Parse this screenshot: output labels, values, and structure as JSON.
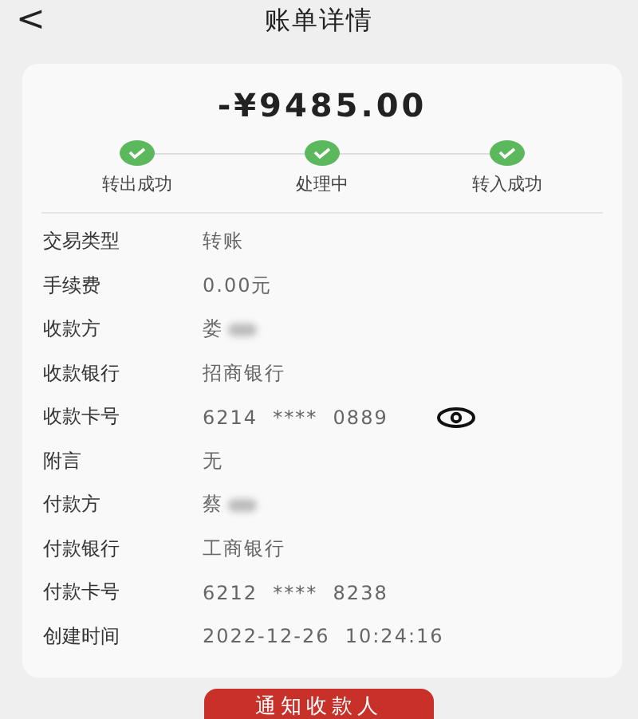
{
  "header": {
    "back": "<",
    "title": "账单详情"
  },
  "amount": "-¥9485.00",
  "steps": [
    {
      "label": "转出成功",
      "done": true
    },
    {
      "label": "处理中",
      "done": true
    },
    {
      "label": "转入成功",
      "done": true
    }
  ],
  "details": [
    {
      "label": "交易类型",
      "value": "转账",
      "kind": "text"
    },
    {
      "label": "手续费",
      "value": "0.00元",
      "kind": "text"
    },
    {
      "label": "收款方",
      "value": "娄",
      "kind": "masked"
    },
    {
      "label": "收款银行",
      "value": "招商银行",
      "kind": "text"
    },
    {
      "label": "收款卡号",
      "value": "6214  ****  0889",
      "kind": "card"
    },
    {
      "label": "附言",
      "value": "无",
      "kind": "text"
    },
    {
      "label": "付款方",
      "value": "蔡",
      "kind": "masked"
    },
    {
      "label": "付款银行",
      "value": "工商银行",
      "kind": "text"
    },
    {
      "label": "付款卡号",
      "value": "6212  ****  8238",
      "kind": "text"
    },
    {
      "label": "创建时间",
      "value": "2022-12-26  10:24:16",
      "kind": "text"
    }
  ],
  "button": "通知收款人"
}
